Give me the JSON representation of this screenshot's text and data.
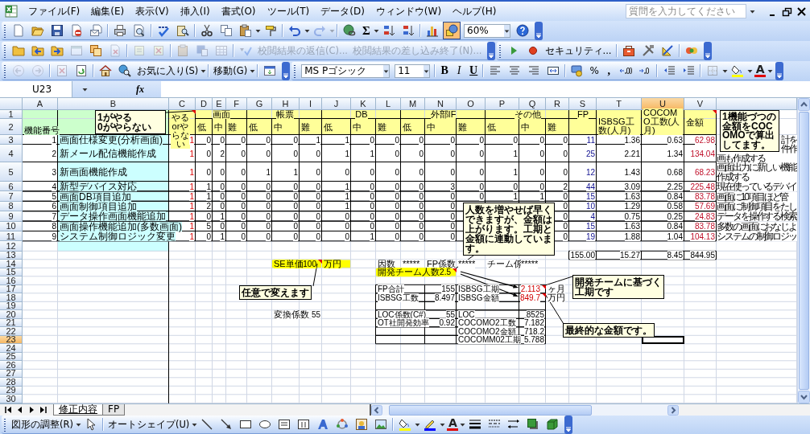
{
  "menu_bar": {
    "items": [
      "ファイル(F)",
      "編集(E)",
      "表示(V)",
      "挿入(I)",
      "書式(O)",
      "ツール(T)",
      "データ(D)",
      "ウィンドウ(W)",
      "ヘルプ(H)"
    ],
    "help_search": {
      "placeholder": "質問を入力してください"
    }
  },
  "standard_toolbar": {
    "autosum": "Σ",
    "zoom": "60%",
    "buttons": [
      {
        "disabled": false
      },
      {
        "disabled": false
      },
      {
        "disabled": false
      },
      {
        "disabled": false
      },
      {
        "disabled": false
      },
      {
        "disabled": false
      },
      {
        "disabled": false
      },
      {
        "disabled": false
      },
      {
        "disabled": false
      },
      {
        "disabled": false
      },
      {
        "disabled": false
      },
      {
        "disabled": false
      },
      {
        "disabled": false
      },
      {
        "disabled": false
      },
      {
        "disabled": true
      },
      {
        "disabled": false
      },
      {
        "disabled": false
      },
      {
        "disabled": false
      },
      {
        "disabled": false
      },
      {
        "disabled": false,
        "selected": true
      },
      {
        "disabled": false
      }
    ]
  },
  "reviewing_toolbar": {
    "buttons": [
      {
        "disabled": false
      },
      {
        "disabled": false
      },
      {
        "disabled": false
      },
      {
        "disabled": true
      },
      {
        "disabled": false
      },
      {
        "disabled": true
      },
      {
        "disabled": true
      },
      {
        "disabled": true
      },
      {
        "disabled": true
      },
      {
        "disabled": true
      },
      {
        "disabled": true
      },
      {
        "disabled": true
      }
    ],
    "items": [
      {
        "label": "校閲結果の返信(C)...",
        "disabled": true
      },
      {
        "label": "校閲結果の差し込み終了(N)...",
        "disabled": true
      }
    ]
  },
  "visual_basic_toolbar": {
    "security": "セキュリティ..."
  },
  "web_toolbar": {
    "favorites": "お気に入り(S)",
    "go": "移動(G)",
    "buttons": [
      {
        "disabled": true
      },
      {
        "disabled": true
      },
      {
        "disabled": true
      },
      {
        "disabled": false
      },
      {
        "disabled": false
      },
      {
        "disabled": false
      },
      {
        "disabled": false
      }
    ]
  },
  "formatting_toolbar": {
    "font": "MS Pゴシック",
    "size": "11",
    "bold": "B",
    "italic": "I",
    "underline": "U",
    "percent": "%",
    "comma": ",",
    "font_color": "A"
  },
  "formula_bar": {
    "name_box": "U23",
    "function_label": "fx"
  },
  "sheet": {
    "columns": [
      {
        "label": "A",
        "selected": false
      },
      {
        "label": "B",
        "selected": false
      },
      {
        "label": "C",
        "selected": false
      },
      {
        "label": "D",
        "selected": false
      },
      {
        "label": "E",
        "selected": false
      },
      {
        "label": "F",
        "selected": false
      },
      {
        "label": "G",
        "selected": false
      },
      {
        "label": "H",
        "selected": false
      },
      {
        "label": "I",
        "selected": false
      },
      {
        "label": "J",
        "selected": false
      },
      {
        "label": "K",
        "selected": false
      },
      {
        "label": "L",
        "selected": false
      },
      {
        "label": "M",
        "selected": false
      },
      {
        "label": "N",
        "selected": false
      },
      {
        "label": "O",
        "selected": false
      },
      {
        "label": "P",
        "selected": false
      },
      {
        "label": "Q",
        "selected": false
      },
      {
        "label": "R",
        "selected": false
      },
      {
        "label": "S",
        "selected": false
      },
      {
        "label": "T",
        "selected": false
      },
      {
        "label": "U",
        "selected": true
      },
      {
        "label": "V",
        "selected": false
      }
    ],
    "header": {
      "number": "機能番号",
      "do_flag": "やるorやらない",
      "groups": [
        {
          "label": "画面",
          "subs": [
            "低",
            "中",
            "難"
          ]
        },
        {
          "label": "帳票",
          "subs": [
            "低",
            "中",
            "難"
          ]
        },
        {
          "label": "DB",
          "subs": [
            "低",
            "中",
            "難"
          ]
        },
        {
          "label": "外部IF",
          "subs": [
            "低",
            "中",
            "難"
          ]
        },
        {
          "label": "その他",
          "subs": [
            "低",
            "中",
            "難"
          ]
        }
      ],
      "fp": "FP",
      "isbsg_effort": "ISBSG工数(人月)",
      "cocomo_effort": "COCOMO工数(人月)",
      "amount": "金額"
    },
    "rows": [
      {
        "number": "1",
        "selected": false
      },
      {
        "number": "2",
        "selected": false
      },
      {
        "number": "3",
        "selected": false,
        "cells": [
          "1",
          "画面仕様変更(分析画面)",
          "1",
          "0",
          "0",
          "0",
          "0",
          "0",
          "1",
          "1",
          "0",
          "0",
          "0",
          "0",
          "0",
          "0",
          "0",
          "0",
          "11",
          "1.36",
          "0.63",
          "62.98",
          "計を"
        ]
      },
      {
        "number": "4",
        "selected": false,
        "cells": [
          "2",
          "新メール配信機能作成",
          "1",
          "0",
          "2",
          "0",
          "0",
          "0",
          "0",
          "1",
          "1",
          "0",
          "0",
          "0",
          "0",
          "1",
          "0",
          "0",
          "25",
          "2.21",
          "1.34",
          "134.04",
          [
            "件作",
            "画も作成する"
          ]
        ]
      },
      {
        "number": "5",
        "selected": false,
        "cells": [
          "3",
          "新画面機能作成",
          "1",
          "0",
          "0",
          "0",
          "1",
          "1",
          "0",
          "0",
          "0",
          "0",
          "0",
          "0",
          "0",
          "1",
          "0",
          "0",
          "12",
          "1.43",
          "0.68",
          "68.23",
          "画面出力に新しい機能作成する"
        ]
      },
      {
        "number": "6",
        "selected": false,
        "cells": [
          "4",
          "新型デバイス対応",
          "1",
          "1",
          "0",
          "0",
          "0",
          "0",
          "0",
          "1",
          "0",
          "0",
          "0",
          "3",
          "0",
          "0",
          "0",
          "2",
          "44",
          "3.09",
          "2.25",
          "225.48",
          "現在使っているデバイ"
        ]
      },
      {
        "number": "7",
        "selected": false,
        "cells": [
          "5",
          "画面DB項目追加",
          "1",
          "1",
          "0",
          "0",
          "0",
          "0",
          "0",
          "1",
          "0",
          "0",
          "0",
          "0",
          "0",
          "1",
          "1",
          "0",
          "15",
          "1.63",
          "0.84",
          "83.78",
          "画面に10項目ほど管"
        ]
      },
      {
        "number": "8",
        "selected": false,
        "cells": [
          "6",
          "画面制御項目追加",
          "1",
          "2",
          "0",
          "0",
          "0",
          "0",
          "0",
          "1",
          "0",
          "0",
          "0",
          "0",
          null,
          null,
          null,
          "0",
          "10",
          "1.29",
          "0.58",
          "57.69",
          "画面に制御項目をたし"
        ]
      },
      {
        "number": "9",
        "selected": false,
        "cells": [
          "7",
          "データ操作画面機能追加",
          "1",
          "0",
          "1",
          "0",
          "0",
          "0",
          "0",
          "0",
          "0",
          "0",
          "0",
          "0",
          null,
          null,
          null,
          "0",
          "4",
          "0.75",
          "0.25",
          "24.83",
          "データを操作する検索"
        ]
      },
      {
        "number": "10",
        "selected": false,
        "cells": [
          "8",
          "画面操作機能追加(多数画面)",
          "1",
          "5",
          "0",
          "0",
          "0",
          "0",
          "0",
          "0",
          "0",
          "0",
          "0",
          "0",
          null,
          null,
          null,
          "0",
          "15",
          "1.63",
          "0.84",
          "83.78",
          "多数の画面におなじよ"
        ]
      },
      {
        "number": "11",
        "selected": false,
        "cells": [
          "9",
          "システム制御ロジック変更",
          "1",
          "0",
          "1",
          "0",
          "0",
          "0",
          "0",
          "0",
          "1",
          "0",
          "0",
          "0",
          null,
          null,
          null,
          "0",
          "19",
          "1.88",
          "1.04",
          "104.13",
          "システムの制御ロジッ"
        ]
      },
      {
        "number": "12",
        "selected": false
      },
      {
        "number": "13",
        "selected": false,
        "cells": [
          null,
          null,
          null,
          null,
          null,
          null,
          null,
          null,
          null,
          null,
          null,
          null,
          null,
          null,
          null,
          null,
          null,
          null,
          "155.00",
          "15.27",
          "8.45",
          "844.95"
        ]
      },
      {
        "number": "14",
        "selected": false,
        "cells": [
          null,
          null,
          null,
          null,
          null,
          null,
          null,
          "SE単価",
          "100",
          "万円",
          null,
          "因数",
          "*****",
          "FP係数",
          "*****",
          "チーム係",
          "*****"
        ]
      },
      {
        "number": "15",
        "selected": false,
        "cells": [
          null,
          null,
          null,
          null,
          null,
          null,
          null,
          null,
          null,
          null,
          null,
          "開発チーム人数",
          null,
          "2.5"
        ]
      },
      {
        "number": "16",
        "selected": false
      },
      {
        "number": "17",
        "selected": false,
        "cells": [
          null,
          null,
          null,
          null,
          null,
          null,
          null,
          null,
          null,
          null,
          null,
          "FP合計",
          null,
          "155",
          "ISBSG工期",
          null,
          "2.113",
          "ヶ月"
        ]
      },
      {
        "number": "18",
        "selected": false,
        "cells": [
          null,
          null,
          null,
          null,
          null,
          null,
          null,
          null,
          null,
          null,
          null,
          "ISBSG工数",
          null,
          "8.497",
          "ISBSG金額",
          null,
          "849.7",
          "万円"
        ]
      },
      {
        "number": "19",
        "selected": false
      },
      {
        "number": "20",
        "selected": false,
        "cells": [
          null,
          null,
          null,
          null,
          null,
          null,
          null,
          "変換係数",
          "55",
          null,
          null,
          "LOC係数(C#)",
          null,
          "55",
          "LOC",
          null,
          "8525"
        ]
      },
      {
        "number": "21",
        "selected": false,
        "cells": [
          null,
          null,
          null,
          null,
          null,
          null,
          null,
          null,
          null,
          null,
          null,
          "OT社開発効率",
          null,
          "0.92",
          "COCOMO2工数",
          null,
          "7.182"
        ]
      },
      {
        "number": "22",
        "selected": false,
        "cells": [
          null,
          null,
          null,
          null,
          null,
          null,
          null,
          null,
          null,
          null,
          null,
          null,
          null,
          null,
          "COCOMO2金額",
          null,
          "718.2"
        ]
      },
      {
        "number": "23",
        "selected": true,
        "cells": [
          null,
          null,
          null,
          null,
          null,
          null,
          null,
          null,
          null,
          null,
          null,
          null,
          null,
          null,
          "COCOMM02工期",
          null,
          "5.788"
        ]
      },
      {
        "number": "24",
        "selected": false
      },
      {
        "number": "25",
        "selected": false
      },
      {
        "number": "26",
        "selected": false
      },
      {
        "number": "27",
        "selected": false
      },
      {
        "number": "28",
        "selected": false
      },
      {
        "number": "29",
        "selected": false
      },
      {
        "number": "30",
        "selected": false
      }
    ],
    "comments": [
      {
        "lines": [
          "1がやる",
          "0がやらない"
        ]
      },
      {
        "lines": [
          "1機能づつの金額をCOCOMOで算出してます。"
        ]
      },
      {
        "lines": [
          "人数を増やせば早く",
          "できますが、金額は",
          "上がります。工期と",
          "金額に連動していま",
          "す。"
        ]
      },
      {
        "lines": [
          "任意で変えます"
        ]
      },
      {
        "lines": [
          "開発チームに基づく",
          "工期です"
        ]
      },
      {
        "lines": [
          "最終的な金額です。"
        ]
      }
    ]
  },
  "sheet_tabs": [
    {
      "label": "修正内容",
      "selected": true
    },
    {
      "label": "FP",
      "selected": false
    }
  ],
  "drawing_toolbar": {
    "draw_menu": "図形の調整(R)",
    "autoshapes_menu": "オートシェイプ(U)",
    "font_color": "A"
  }
}
